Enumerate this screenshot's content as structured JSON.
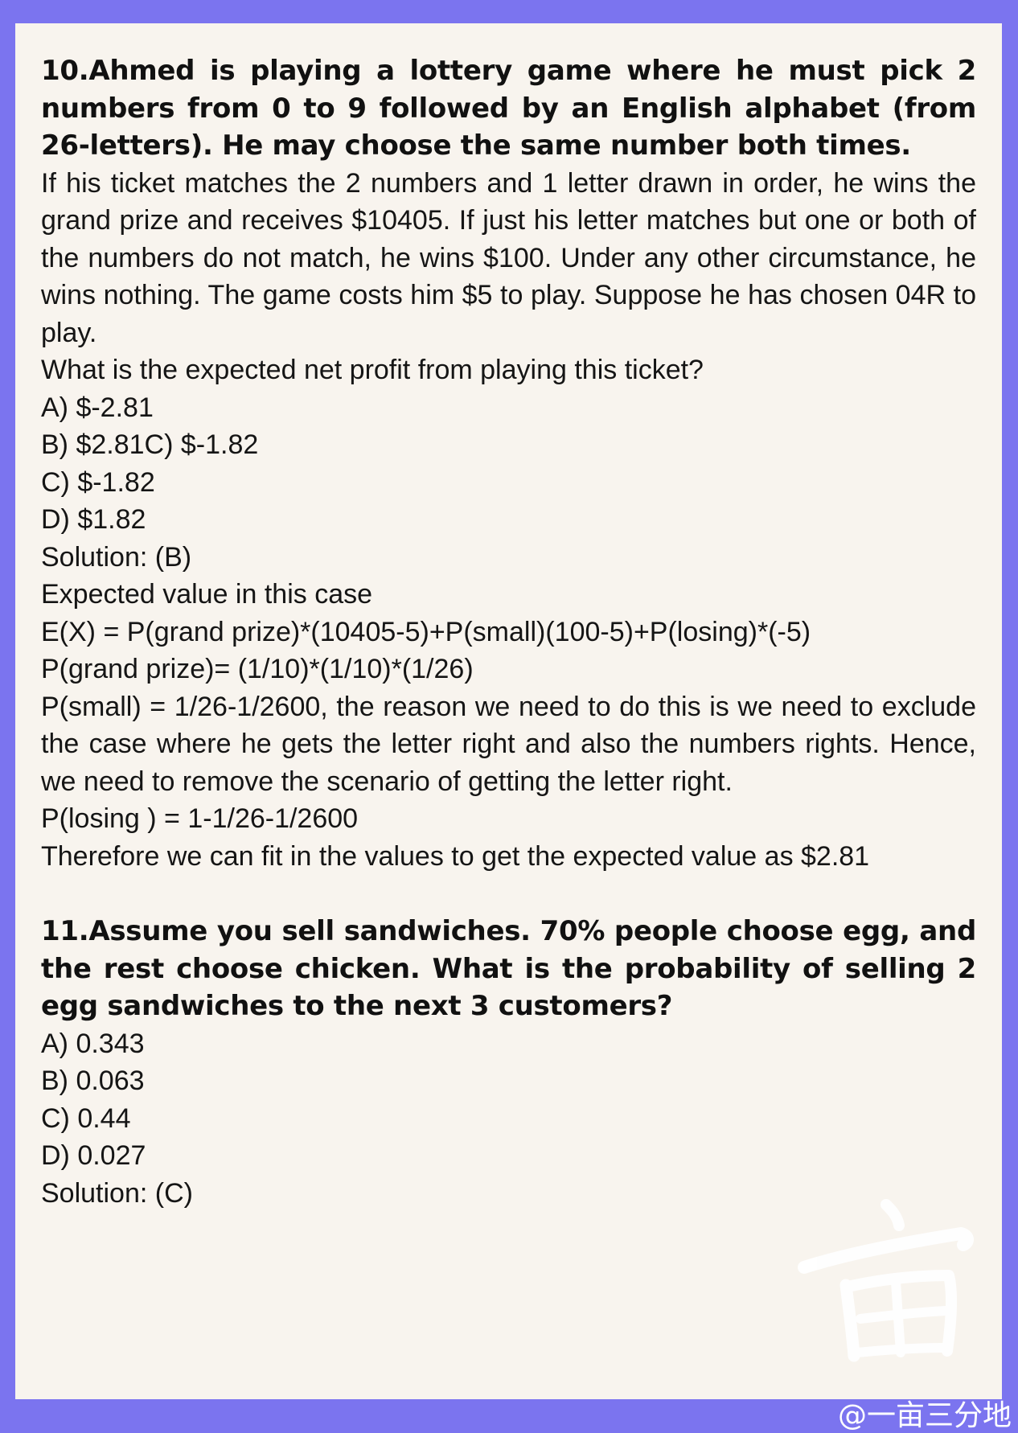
{
  "q10": {
    "heading": "10.Ahmed is playing a lottery game where he must pick 2 numbers from 0 to 9 followed by an English alphabet (from 26-letters). He may choose the same number both times.",
    "body": "If his ticket matches the 2 numbers and 1 letter drawn in order, he wins the grand prize and receives $10405. If just his letter matches but one or both of the numbers do not match, he wins $100. Under any other circumstance, he wins nothing. The game costs him $5 to play. Suppose he has chosen 04R to play.",
    "question": "What is the expected net profit from playing this ticket?",
    "options": [
      "A) $-2.81",
      "B) $2.81C) $-1.82",
      "C) $-1.82",
      "D) $1.82"
    ],
    "solution": "Solution: (B)",
    "steps": [
      "Expected value in this case",
      "E(X) = P(grand prize)*(10405-5)+P(small)(100-5)+P(losing)*(-5)",
      "P(grand prize)= (1/10)*(1/10)*(1/26)"
    ],
    "explanation": "P(small) = 1/26-1/2600, the reason we need to do this is we need to exclude the case where he gets the letter right and also the numbers rights. Hence, we need to remove the scenario of getting the letter right.",
    "losing": "P(losing ) = 1-1/26-1/2600",
    "conclusion": "Therefore we can fit in the values to get the expected value as $2.81"
  },
  "q11": {
    "heading": "11.Assume you sell sandwiches. 70% people choose egg, and the rest choose chicken. What is the probability of selling 2 egg sandwiches to the next 3 customers?",
    "options": [
      "A) 0.343",
      "B) 0.063",
      "C) 0.44",
      "D) 0.027"
    ],
    "solution": "Solution: (C)"
  },
  "watermark": {
    "seal_char": "亩",
    "credit": "@一亩三分地"
  },
  "colors": {
    "border": "#7b74ef",
    "paper": "#f8f4ee",
    "text": "#151515"
  }
}
